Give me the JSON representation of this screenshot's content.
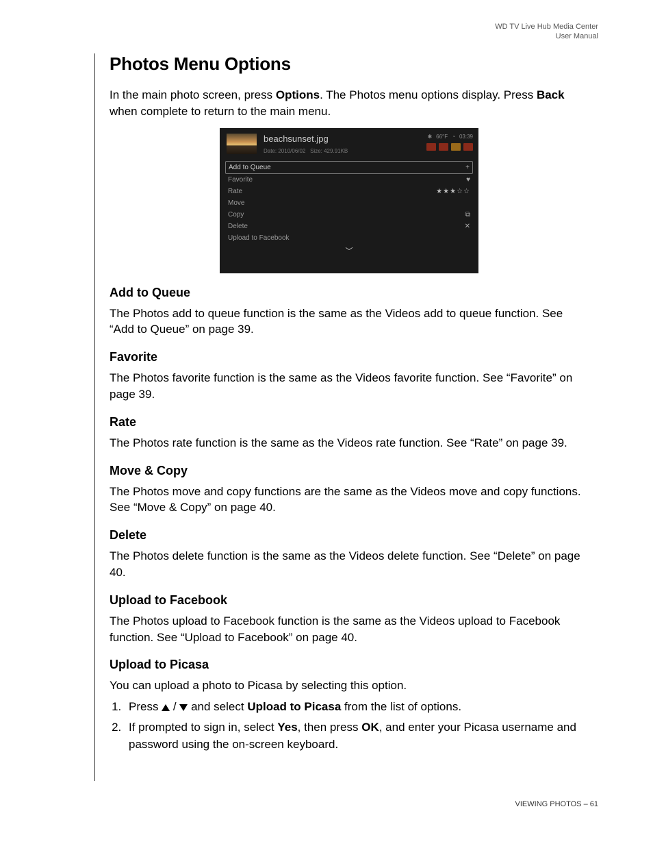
{
  "header": {
    "line1": "WD TV Live Hub Media Center",
    "line2": "User Manual"
  },
  "title": "Photos Menu Options",
  "intro": {
    "pre": "In the main photo screen, press ",
    "bold1": "Options",
    "mid": ". The Photos menu options display. Press ",
    "bold2": "Back",
    "post": " when complete to return to the main menu."
  },
  "screenshot": {
    "filename": "beachsunset.jpg",
    "meta_date_label": "Date:",
    "meta_date": "2010/06/02",
    "meta_size_label": "Size:",
    "meta_size": "429.91KB",
    "temp": "66°F",
    "time": "03:39",
    "options": {
      "add_to_queue": "Add to Queue",
      "favorite": "Favorite",
      "rate": "Rate",
      "move": "Move",
      "copy": "Copy",
      "delete": "Delete",
      "upload_fb": "Upload to Facebook"
    }
  },
  "sections": {
    "add_to_queue": {
      "heading": "Add to Queue",
      "body": "The Photos add to queue function is the same as the Videos add to queue function. See “Add to Queue” on page 39."
    },
    "favorite": {
      "heading": "Favorite",
      "body": "The Photos favorite function is the same as the Videos favorite function. See “Favorite” on page 39."
    },
    "rate": {
      "heading": "Rate",
      "body": "The Photos rate function is the same as the Videos rate function. See “Rate” on page 39."
    },
    "move_copy": {
      "heading": "Move & Copy",
      "body": "The Photos move and copy functions are the same as the Videos move and copy functions. See “Move & Copy” on page 40."
    },
    "delete": {
      "heading": "Delete",
      "body": "The Photos delete function is the same as the Videos delete function. See “Delete” on page 40."
    },
    "upload_fb": {
      "heading": "Upload to Facebook",
      "body": "The Photos upload to Facebook function is the same as the Videos upload to Facebook function. See “Upload to Facebook” on page 40."
    },
    "upload_picasa": {
      "heading": "Upload to Picasa",
      "body": "You can upload a photo to Picasa by selecting this option.",
      "step1_pre": "Press ",
      "step1_mid": " / ",
      "step1_post1": " and select ",
      "step1_bold": "Upload to Picasa",
      "step1_post2": " from the list of options.",
      "step2_pre": "If prompted to sign in, select ",
      "step2_b1": "Yes",
      "step2_mid1": ", then press ",
      "step2_b2": "OK",
      "step2_post": ", and enter your Picasa username and password using the on-screen keyboard."
    }
  },
  "footer": {
    "section": "VIEWING PHOTOS",
    "sep": " – ",
    "page": "61"
  }
}
